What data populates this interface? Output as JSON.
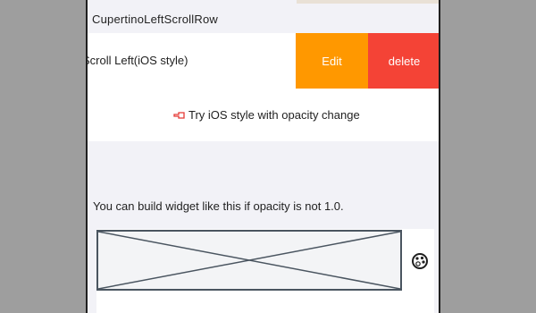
{
  "section_header": "CupertinoLeftScrollRow",
  "row": {
    "title": "Scroll Left(iOS style)",
    "edit_label": "Edit",
    "delete_label": "delete"
  },
  "try_link": {
    "icon": "hand-point-icon",
    "label": "Try iOS style with opacity change"
  },
  "note": "You can build widget like this if opacity is not 1.0.",
  "placeholder_icon": "palette-icon",
  "colors": {
    "edit": "#ff9800",
    "delete": "#f44336",
    "background": "#f2f2f7",
    "overlay": "#9e9e9e"
  }
}
